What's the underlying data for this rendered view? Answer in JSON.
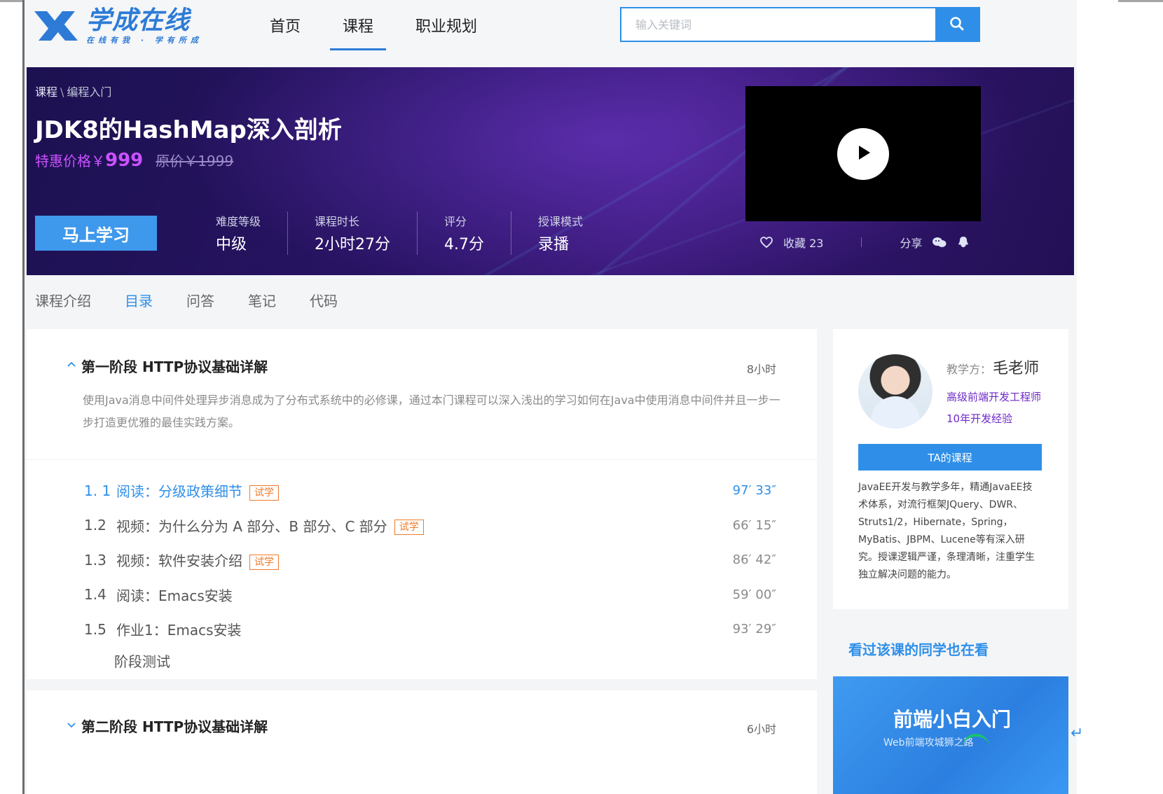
{
  "colors": {
    "accent": "#2f8fe8",
    "price": "#cb51ff",
    "badge": "#f07a2a",
    "teacher_meta": "#6f2bc8",
    "banner_dark": "#221055"
  },
  "header": {
    "logo_title": "学成在线",
    "logo_slogan": "在线有我 · 学有所成",
    "nav": [
      {
        "label": "首页",
        "active": false
      },
      {
        "label": "课程",
        "active": true
      },
      {
        "label": "职业规划",
        "active": false
      }
    ],
    "search": {
      "placeholder": "输入关键词",
      "value": "",
      "button_icon": "search-icon"
    }
  },
  "banner": {
    "breadcrumb": {
      "parent": "课程",
      "separator": "\\",
      "current": "编程入门"
    },
    "title": "JDK8的HashMap深入剖析",
    "price_label": "特惠价格￥",
    "price_amount": "999",
    "original_price": "原价￥1999",
    "cta_label": "马上学习",
    "meta": [
      {
        "label": "难度等级",
        "value": "中级"
      },
      {
        "label": "课程时长",
        "value": "2小时27分"
      },
      {
        "label": "评分",
        "value": "4.7分"
      },
      {
        "label": "授课模式",
        "value": "录播"
      }
    ],
    "video": {
      "play_icon": "play-icon"
    },
    "social": {
      "favorite_icon": "heart-icon",
      "favorite_label": "收藏 23",
      "share_label": "分享",
      "wechat_icon": "wechat-icon",
      "qq_icon": "qq-icon"
    }
  },
  "tabs": [
    {
      "label": "课程介绍",
      "active": false
    },
    {
      "label": "目录",
      "active": true
    },
    {
      "label": "问答",
      "active": false
    },
    {
      "label": "笔记",
      "active": false
    },
    {
      "label": "代码",
      "active": false
    }
  ],
  "stages": [
    {
      "title": "第一阶段  HTTP协议基础详解",
      "duration": "8小时",
      "expanded": true,
      "description": "使用Java消息中间件处理异步消息成为了分布式系统中的必修课，通过本门课程可以深入浅出的学习如何在Java中使用消息中间件并且一步一步打造更优雅的最佳实践方案。",
      "lessons": [
        {
          "num": "1. 1",
          "name": "阅读：分级政策细节",
          "badge": "试学",
          "time": "97′ 33″",
          "active": true
        },
        {
          "num": "1.2",
          "name": "视频：为什么分为 A 部分、B 部分、C 部分",
          "badge": "试学",
          "time": "66′ 15″",
          "active": false
        },
        {
          "num": "1.3",
          "name": "视频：软件安装介绍",
          "badge": "试学",
          "time": "86′ 42″",
          "active": false
        },
        {
          "num": "1.4",
          "name": "阅读：Emacs安装",
          "badge": "",
          "time": "59′ 00″",
          "active": false
        },
        {
          "num": "1.5",
          "name": "作业1：Emacs安装",
          "badge": "",
          "time": "93′ 29″",
          "active": false
        }
      ],
      "stage_test": "阶段测试"
    },
    {
      "title": "第二阶段  HTTP协议基础详解",
      "duration": "6小时",
      "expanded": false
    }
  ],
  "teacher": {
    "role_label": "教学方：",
    "name": "毛老师",
    "title": "高级前端开发工程师",
    "experience": "10年开发经验",
    "button_label": "TA的课程",
    "description": "JavaEE开发与教学多年，精通JavaEE技术体系，对流行框架JQuery、DWR、Struts1/2，Hibernate，Spring，MyBatis、JBPM、Lucene等有深入研究。授课逻辑严谨，条理清晰，注重学生独立解决问题的能力。"
  },
  "sidebar": {
    "also_title": "看过该课的同学也在看",
    "promo_title": "前端小白入门",
    "promo_sub": "Web前端攻城狮之路"
  }
}
